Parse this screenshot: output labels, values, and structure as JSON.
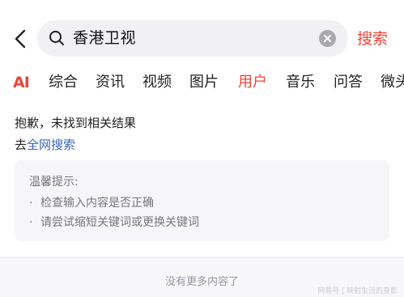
{
  "search": {
    "query": "香港卫视",
    "button_label": "搜索"
  },
  "tabs": [
    {
      "label": "AI"
    },
    {
      "label": "综合"
    },
    {
      "label": "资讯"
    },
    {
      "label": "视频"
    },
    {
      "label": "图片"
    },
    {
      "label": "用户",
      "active": true
    },
    {
      "label": "音乐"
    },
    {
      "label": "问答"
    },
    {
      "label": "微头"
    }
  ],
  "result": {
    "message": "抱歉，未找到相关结果",
    "goto_prefix": "去",
    "goto_link": "全网搜索"
  },
  "tips": {
    "title": "温馨提示:",
    "items": [
      "检查输入内容是否正确",
      "请尝试缩短关键词或更换关键词"
    ]
  },
  "footer": {
    "no_more": "没有更多内容了"
  },
  "watermark": "网易号 | 映射生活的身影",
  "colors": {
    "accent": "#e8463a",
    "link": "#3a64b0"
  },
  "icons": {
    "back": "back-chevron-icon",
    "search": "search-icon",
    "clear": "clear-icon"
  }
}
